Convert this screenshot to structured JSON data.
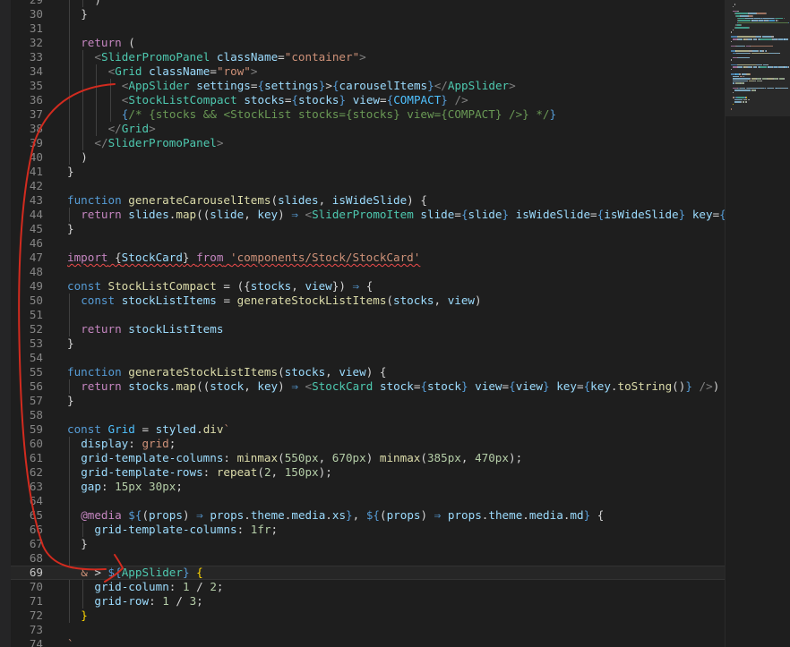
{
  "editor": {
    "language": "javascript",
    "first_line": 29,
    "last_line": 74,
    "current_line": 69
  },
  "theme": {
    "background": "#1e1e1e",
    "keyword": "#569cd6",
    "control": "#c586c0",
    "function": "#dcdcaa",
    "variable": "#9cdcfe",
    "constant": "#4fc1ff",
    "string": "#ce9178",
    "number": "#b5cea8",
    "type": "#4ec9b0",
    "comment": "#6a9955",
    "annotation_arrow": "#d22b1f"
  },
  "lines": [
    {
      "n": "29",
      "indent": 4,
      "tokens": [
        [
          "p",
          ")"
        ]
      ]
    },
    {
      "n": "30",
      "indent": 2,
      "tokens": [
        [
          "p",
          "}"
        ]
      ]
    },
    {
      "n": "31",
      "indent": 0,
      "tokens": []
    },
    {
      "n": "32",
      "indent": 2,
      "tokens": [
        [
          "kc",
          "return"
        ],
        [
          "p",
          " ("
        ]
      ]
    },
    {
      "n": "33",
      "indent": 4,
      "tokens": [
        [
          "tg",
          "<"
        ],
        [
          "t",
          "SliderPromoPanel"
        ],
        [
          "p",
          " "
        ],
        [
          "v",
          "className"
        ],
        [
          "p",
          "="
        ],
        [
          "s",
          "\"container\""
        ],
        [
          "tg",
          ">"
        ]
      ]
    },
    {
      "n": "34",
      "indent": 6,
      "tokens": [
        [
          "tg",
          "<"
        ],
        [
          "t",
          "Grid"
        ],
        [
          "p",
          " "
        ],
        [
          "v",
          "className"
        ],
        [
          "p",
          "="
        ],
        [
          "s",
          "\"row\""
        ],
        [
          "tg",
          ">"
        ]
      ]
    },
    {
      "n": "35",
      "indent": 8,
      "tokens": [
        [
          "tg",
          "<"
        ],
        [
          "t",
          "AppSlider"
        ],
        [
          "p",
          " "
        ],
        [
          "v",
          "settings"
        ],
        [
          "p",
          "="
        ],
        [
          "k",
          "{"
        ],
        [
          "v",
          "settings"
        ],
        [
          "k",
          "}"
        ],
        [
          "p",
          ">"
        ],
        [
          "k",
          "{"
        ],
        [
          "v",
          "carouselItems"
        ],
        [
          "k",
          "}"
        ],
        [
          "tg",
          "</"
        ],
        [
          "t",
          "AppSlider"
        ],
        [
          "tg",
          ">"
        ]
      ]
    },
    {
      "n": "36",
      "indent": 8,
      "tokens": [
        [
          "tg",
          "<"
        ],
        [
          "t",
          "StockListCompact"
        ],
        [
          "p",
          " "
        ],
        [
          "v",
          "stocks"
        ],
        [
          "p",
          "="
        ],
        [
          "k",
          "{"
        ],
        [
          "v",
          "stocks"
        ],
        [
          "k",
          "}"
        ],
        [
          "p",
          " "
        ],
        [
          "v",
          "view"
        ],
        [
          "p",
          "="
        ],
        [
          "k",
          "{"
        ],
        [
          "c",
          "COMPACT"
        ],
        [
          "k",
          "}"
        ],
        [
          "p",
          " "
        ],
        [
          "tg",
          "/>"
        ]
      ]
    },
    {
      "n": "37",
      "indent": 8,
      "tokens": [
        [
          "k",
          "{"
        ],
        [
          "cm",
          "/* {stocks && <StockList stocks={stocks} view={COMPACT} />} */"
        ],
        [
          "k",
          "}"
        ]
      ]
    },
    {
      "n": "38",
      "indent": 6,
      "tokens": [
        [
          "tg",
          "</"
        ],
        [
          "t",
          "Grid"
        ],
        [
          "tg",
          ">"
        ]
      ]
    },
    {
      "n": "39",
      "indent": 4,
      "tokens": [
        [
          "tg",
          "</"
        ],
        [
          "t",
          "SliderPromoPanel"
        ],
        [
          "tg",
          ">"
        ]
      ]
    },
    {
      "n": "40",
      "indent": 2,
      "tokens": [
        [
          "p",
          ")"
        ]
      ]
    },
    {
      "n": "41",
      "indent": 0,
      "tokens": [
        [
          "p",
          "}"
        ]
      ]
    },
    {
      "n": "42",
      "indent": 0,
      "tokens": []
    },
    {
      "n": "43",
      "indent": 0,
      "tokens": [
        [
          "k",
          "function"
        ],
        [
          "p",
          " "
        ],
        [
          "f",
          "generateCarouselItems"
        ],
        [
          "p",
          "("
        ],
        [
          "v",
          "slides"
        ],
        [
          "p",
          ", "
        ],
        [
          "v",
          "isWideSlide"
        ],
        [
          "p",
          ") {"
        ]
      ]
    },
    {
      "n": "44",
      "indent": 2,
      "tokens": [
        [
          "kc",
          "return"
        ],
        [
          "p",
          " "
        ],
        [
          "v",
          "slides"
        ],
        [
          "p",
          "."
        ],
        [
          "f",
          "map"
        ],
        [
          "p",
          "(("
        ],
        [
          "v",
          "slide"
        ],
        [
          "p",
          ", "
        ],
        [
          "v",
          "key"
        ],
        [
          "p",
          ") "
        ],
        [
          "k",
          "⇒"
        ],
        [
          "p",
          " "
        ],
        [
          "tg",
          "<"
        ],
        [
          "t",
          "SliderPromoItem"
        ],
        [
          "p",
          " "
        ],
        [
          "v",
          "slide"
        ],
        [
          "p",
          "="
        ],
        [
          "k",
          "{"
        ],
        [
          "v",
          "slide"
        ],
        [
          "k",
          "}"
        ],
        [
          "p",
          " "
        ],
        [
          "v",
          "isWideSlide"
        ],
        [
          "p",
          "="
        ],
        [
          "k",
          "{"
        ],
        [
          "v",
          "isWideSlide"
        ],
        [
          "k",
          "}"
        ],
        [
          "p",
          " "
        ],
        [
          "v",
          "key"
        ],
        [
          "p",
          "="
        ],
        [
          "k",
          "{"
        ],
        [
          "v",
          "ke"
        ]
      ]
    },
    {
      "n": "45",
      "indent": 0,
      "tokens": [
        [
          "p",
          "}"
        ]
      ]
    },
    {
      "n": "46",
      "indent": 0,
      "tokens": []
    },
    {
      "n": "47",
      "indent": 0,
      "tokens": [
        [
          "kc err",
          "import"
        ],
        [
          "p err",
          " {"
        ],
        [
          "v err",
          "StockCard"
        ],
        [
          "p err",
          "} "
        ],
        [
          "kc err",
          "from"
        ],
        [
          "p err",
          " "
        ],
        [
          "s err",
          "'components/Stock/StockCard'"
        ]
      ]
    },
    {
      "n": "48",
      "indent": 0,
      "tokens": []
    },
    {
      "n": "49",
      "indent": 0,
      "tokens": [
        [
          "k",
          "const"
        ],
        [
          "p",
          " "
        ],
        [
          "f",
          "StockListCompact"
        ],
        [
          "p",
          " = ({"
        ],
        [
          "v",
          "stocks"
        ],
        [
          "p",
          ", "
        ],
        [
          "v",
          "view"
        ],
        [
          "p",
          "}) "
        ],
        [
          "k",
          "⇒"
        ],
        [
          "p",
          " {"
        ]
      ]
    },
    {
      "n": "50",
      "indent": 2,
      "tokens": [
        [
          "k",
          "const"
        ],
        [
          "p",
          " "
        ],
        [
          "v",
          "stockListItems"
        ],
        [
          "p",
          " = "
        ],
        [
          "f",
          "generateStockListItems"
        ],
        [
          "p",
          "("
        ],
        [
          "v",
          "stocks"
        ],
        [
          "p",
          ", "
        ],
        [
          "v",
          "view"
        ],
        [
          "p",
          ")"
        ]
      ]
    },
    {
      "n": "51",
      "indent": 0,
      "tokens": []
    },
    {
      "n": "52",
      "indent": 2,
      "tokens": [
        [
          "kc",
          "return"
        ],
        [
          "p",
          " "
        ],
        [
          "v",
          "stockListItems"
        ]
      ]
    },
    {
      "n": "53",
      "indent": 0,
      "tokens": [
        [
          "p",
          "}"
        ]
      ]
    },
    {
      "n": "54",
      "indent": 0,
      "tokens": []
    },
    {
      "n": "55",
      "indent": 0,
      "tokens": [
        [
          "k",
          "function"
        ],
        [
          "p",
          " "
        ],
        [
          "f",
          "generateStockListItems"
        ],
        [
          "p",
          "("
        ],
        [
          "v",
          "stocks"
        ],
        [
          "p",
          ", "
        ],
        [
          "v",
          "view"
        ],
        [
          "p",
          ") {"
        ]
      ]
    },
    {
      "n": "56",
      "indent": 2,
      "tokens": [
        [
          "kc",
          "return"
        ],
        [
          "p",
          " "
        ],
        [
          "v",
          "stocks"
        ],
        [
          "p",
          "."
        ],
        [
          "f",
          "map"
        ],
        [
          "p",
          "(("
        ],
        [
          "v",
          "stock"
        ],
        [
          "p",
          ", "
        ],
        [
          "v",
          "key"
        ],
        [
          "p",
          ") "
        ],
        [
          "k",
          "⇒"
        ],
        [
          "p",
          " "
        ],
        [
          "tg",
          "<"
        ],
        [
          "t",
          "StockCard"
        ],
        [
          "p",
          " "
        ],
        [
          "v",
          "stock"
        ],
        [
          "p",
          "="
        ],
        [
          "k",
          "{"
        ],
        [
          "v",
          "stock"
        ],
        [
          "k",
          "}"
        ],
        [
          "p",
          " "
        ],
        [
          "v",
          "view"
        ],
        [
          "p",
          "="
        ],
        [
          "k",
          "{"
        ],
        [
          "v",
          "view"
        ],
        [
          "k",
          "}"
        ],
        [
          "p",
          " "
        ],
        [
          "v",
          "key"
        ],
        [
          "p",
          "="
        ],
        [
          "k",
          "{"
        ],
        [
          "v",
          "key"
        ],
        [
          "p",
          "."
        ],
        [
          "f",
          "toString"
        ],
        [
          "p",
          "()"
        ],
        [
          "k",
          "}"
        ],
        [
          "p",
          " "
        ],
        [
          "tg",
          "/>"
        ],
        [
          "p",
          ")"
        ]
      ]
    },
    {
      "n": "57",
      "indent": 0,
      "tokens": [
        [
          "p",
          "}"
        ]
      ]
    },
    {
      "n": "58",
      "indent": 0,
      "tokens": []
    },
    {
      "n": "59",
      "indent": 0,
      "tokens": [
        [
          "k",
          "const"
        ],
        [
          "p",
          " "
        ],
        [
          "c",
          "Grid"
        ],
        [
          "p",
          " = "
        ],
        [
          "v",
          "styled"
        ],
        [
          "p",
          "."
        ],
        [
          "f",
          "div"
        ],
        [
          "s",
          "`"
        ]
      ]
    },
    {
      "n": "60",
      "indent": 2,
      "tokens": [
        [
          "v",
          "display"
        ],
        [
          "p",
          ": "
        ],
        [
          "s",
          "grid"
        ],
        [
          "p",
          ";"
        ]
      ]
    },
    {
      "n": "61",
      "indent": 2,
      "tokens": [
        [
          "v",
          "grid-template-columns"
        ],
        [
          "p",
          ": "
        ],
        [
          "f",
          "minmax"
        ],
        [
          "p",
          "("
        ],
        [
          "n",
          "550px"
        ],
        [
          "p",
          ", "
        ],
        [
          "n",
          "670px"
        ],
        [
          "p",
          ") "
        ],
        [
          "f",
          "minmax"
        ],
        [
          "p",
          "("
        ],
        [
          "n",
          "385px"
        ],
        [
          "p",
          ", "
        ],
        [
          "n",
          "470px"
        ],
        [
          "p",
          ");"
        ]
      ]
    },
    {
      "n": "62",
      "indent": 2,
      "tokens": [
        [
          "v",
          "grid-template-rows"
        ],
        [
          "p",
          ": "
        ],
        [
          "f",
          "repeat"
        ],
        [
          "p",
          "("
        ],
        [
          "n",
          "2"
        ],
        [
          "p",
          ", "
        ],
        [
          "n",
          "150px"
        ],
        [
          "p",
          ");"
        ]
      ]
    },
    {
      "n": "63",
      "indent": 2,
      "tokens": [
        [
          "v",
          "gap"
        ],
        [
          "p",
          ": "
        ],
        [
          "n",
          "15px"
        ],
        [
          "p",
          " "
        ],
        [
          "n",
          "30px"
        ],
        [
          "p",
          ";"
        ]
      ]
    },
    {
      "n": "64",
      "indent": 0,
      "tokens": []
    },
    {
      "n": "65",
      "indent": 2,
      "tokens": [
        [
          "kc",
          "@media"
        ],
        [
          "p",
          " "
        ],
        [
          "k",
          "${"
        ],
        [
          "p",
          "("
        ],
        [
          "v",
          "props"
        ],
        [
          "p",
          ") "
        ],
        [
          "k",
          "⇒"
        ],
        [
          "p",
          " "
        ],
        [
          "v",
          "props"
        ],
        [
          "p",
          "."
        ],
        [
          "v",
          "theme"
        ],
        [
          "p",
          "."
        ],
        [
          "v",
          "media"
        ],
        [
          "p",
          "."
        ],
        [
          "v",
          "xs"
        ],
        [
          "k",
          "}"
        ],
        [
          "p",
          ", "
        ],
        [
          "k",
          "${"
        ],
        [
          "p",
          "("
        ],
        [
          "v",
          "props"
        ],
        [
          "p",
          ") "
        ],
        [
          "k",
          "⇒"
        ],
        [
          "p",
          " "
        ],
        [
          "v",
          "props"
        ],
        [
          "p",
          "."
        ],
        [
          "v",
          "theme"
        ],
        [
          "p",
          "."
        ],
        [
          "v",
          "media"
        ],
        [
          "p",
          "."
        ],
        [
          "v",
          "md"
        ],
        [
          "k",
          "}"
        ],
        [
          "p",
          " {"
        ]
      ]
    },
    {
      "n": "66",
      "indent": 4,
      "tokens": [
        [
          "v",
          "grid-template-columns"
        ],
        [
          "p",
          ": "
        ],
        [
          "n",
          "1fr"
        ],
        [
          "p",
          ";"
        ]
      ]
    },
    {
      "n": "67",
      "indent": 2,
      "tokens": [
        [
          "p",
          "}"
        ]
      ]
    },
    {
      "n": "68",
      "indent": 0,
      "tokens": []
    },
    {
      "n": "69",
      "indent": 2,
      "tokens": [
        [
          "s",
          "&"
        ],
        [
          "p",
          " > "
        ],
        [
          "k",
          "${"
        ],
        [
          "t",
          "AppSlider"
        ],
        [
          "k",
          "}"
        ],
        [
          "p",
          " "
        ],
        [
          "br1",
          "{"
        ]
      ]
    },
    {
      "n": "70",
      "indent": 4,
      "tokens": [
        [
          "v",
          "grid-column"
        ],
        [
          "p",
          ": "
        ],
        [
          "n",
          "1"
        ],
        [
          "p",
          " / "
        ],
        [
          "n",
          "2"
        ],
        [
          "p",
          ";"
        ]
      ]
    },
    {
      "n": "71",
      "indent": 4,
      "tokens": [
        [
          "v",
          "grid-row"
        ],
        [
          "p",
          ": "
        ],
        [
          "n",
          "1"
        ],
        [
          "p",
          " / "
        ],
        [
          "n",
          "3"
        ],
        [
          "p",
          ";"
        ]
      ]
    },
    {
      "n": "72",
      "indent": 2,
      "tokens": [
        [
          "br1",
          "}"
        ]
      ]
    },
    {
      "n": "73",
      "indent": 0,
      "tokens": []
    },
    {
      "n": "74",
      "indent": 0,
      "tokens": [
        [
          "s",
          "`"
        ]
      ]
    }
  ]
}
